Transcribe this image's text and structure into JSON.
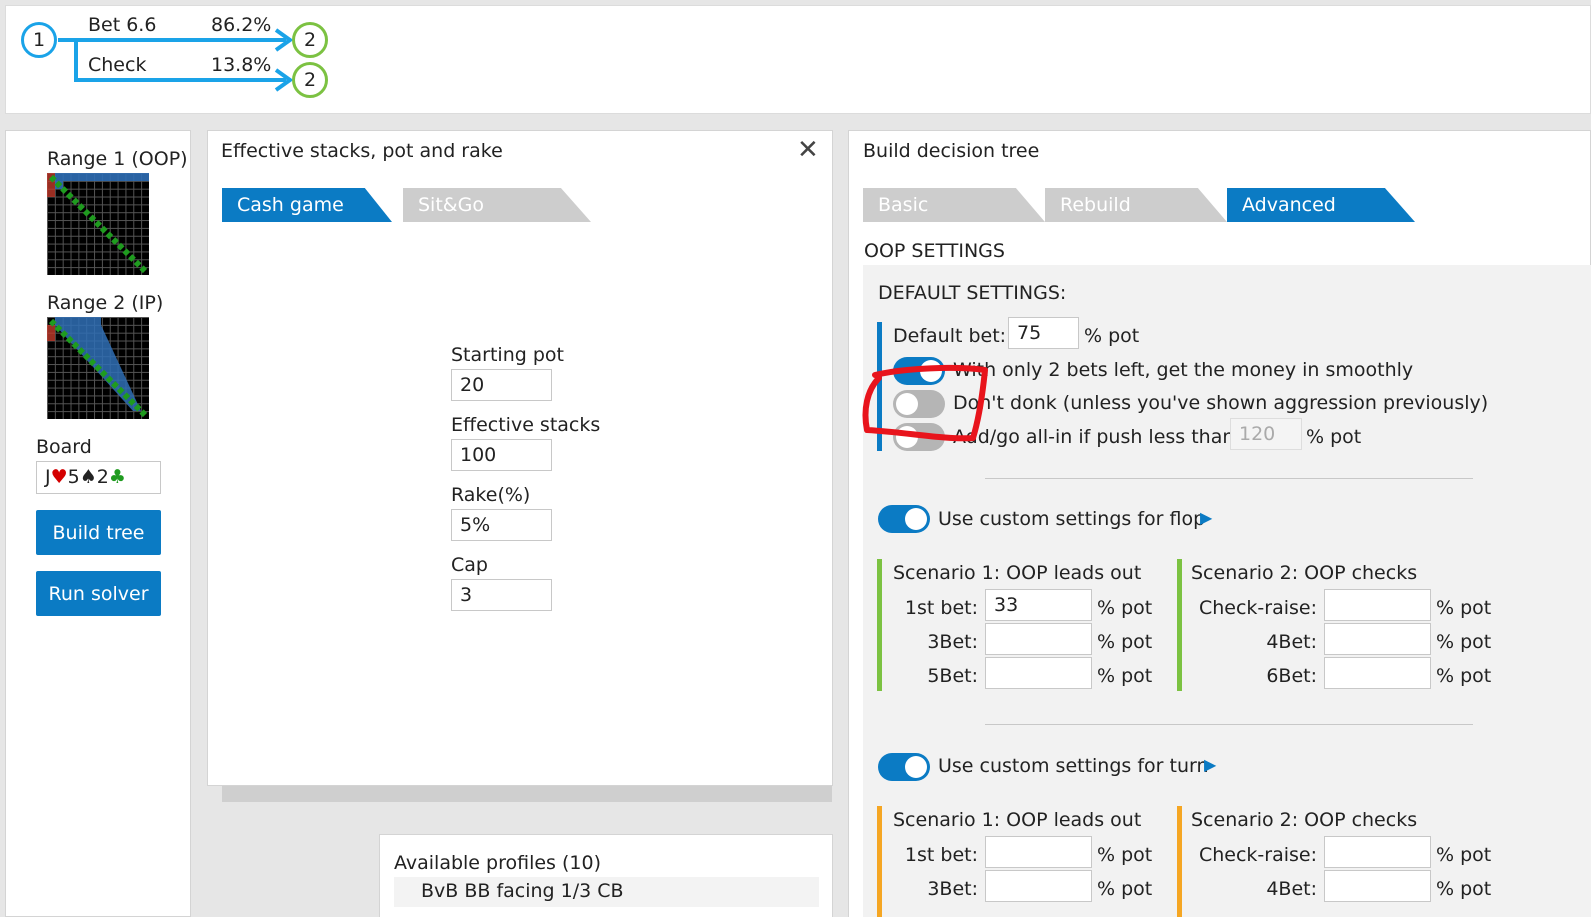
{
  "tree": {
    "root_node": "1",
    "branches": [
      {
        "action": "Bet 6.6",
        "freq": "86.2%",
        "node": "2"
      },
      {
        "action": "Check",
        "freq": "13.8%",
        "node": "2"
      }
    ]
  },
  "left": {
    "range1_label": "Range 1 (OOP)",
    "range2_label": "Range 2 (IP)",
    "board_label": "Board",
    "board_cards": [
      {
        "rank": "J",
        "suit": "♥",
        "color": "#d40000"
      },
      {
        "rank": "5",
        "suit": "♠",
        "color": "#222222"
      },
      {
        "rank": "2",
        "suit": "♣",
        "color": "#1f9b1f"
      }
    ],
    "build_tree_label": "Build tree",
    "run_solver_label": "Run solver"
  },
  "stacks": {
    "title": "Effective stacks, pot and rake",
    "tabs": [
      "Cash game",
      "Sit&Go"
    ],
    "active_tab": "Cash game",
    "fields": [
      {
        "label": "Starting pot",
        "value": "20"
      },
      {
        "label": "Effective stacks",
        "value": "100"
      },
      {
        "label": "Rake(%)",
        "value": "5%"
      },
      {
        "label": "Cap",
        "value": "3"
      }
    ]
  },
  "profiles": {
    "title": "Available profiles (10)",
    "items": [
      "BvB BB facing 1/3 CB"
    ]
  },
  "tree_builder": {
    "title": "Build decision tree",
    "tabs": [
      "Basic",
      "Rebuild",
      "Advanced"
    ],
    "active_tab": "Advanced",
    "section": "OOP SETTINGS",
    "default_settings": {
      "heading": "DEFAULT SETTINGS:",
      "default_bet_label": "Default bet:",
      "default_bet_value": "75",
      "pot_unit": "% pot",
      "toggle1": "With only 2 bets left, get the money in smoothly",
      "toggle2": "Don't donk (unless you've shown aggression previously)",
      "toggle3": "Add/go all-in if push less than",
      "toggle3_value": "120"
    },
    "flop": {
      "toggle_label": "Use custom settings for flop",
      "scenario1_title": "Scenario 1: OOP leads out",
      "scenario2_title": "Scenario 2: OOP checks",
      "s1_rows": [
        {
          "label": "1st bet:",
          "value": "33"
        },
        {
          "label": "3Bet:",
          "value": ""
        },
        {
          "label": "5Bet:",
          "value": ""
        }
      ],
      "s2_rows": [
        {
          "label": "Check-raise:",
          "value": ""
        },
        {
          "label": "4Bet:",
          "value": ""
        },
        {
          "label": "6Bet:",
          "value": ""
        }
      ]
    },
    "turn": {
      "toggle_label": "Use custom settings for turn",
      "scenario1_title": "Scenario 1: OOP leads out",
      "scenario2_title": "Scenario 2: OOP checks",
      "s1_rows": [
        {
          "label": "1st bet:",
          "value": ""
        },
        {
          "label": "3Bet:",
          "value": ""
        }
      ],
      "s2_rows": [
        {
          "label": "Check-raise:",
          "value": ""
        },
        {
          "label": "4Bet:",
          "value": ""
        }
      ]
    }
  },
  "colors": {
    "accent": "#0b7bc4",
    "tree_arrow": "#1aa3e8",
    "green": "#7cc242",
    "orange": "#f5a623",
    "annotation": "#e8141c"
  }
}
